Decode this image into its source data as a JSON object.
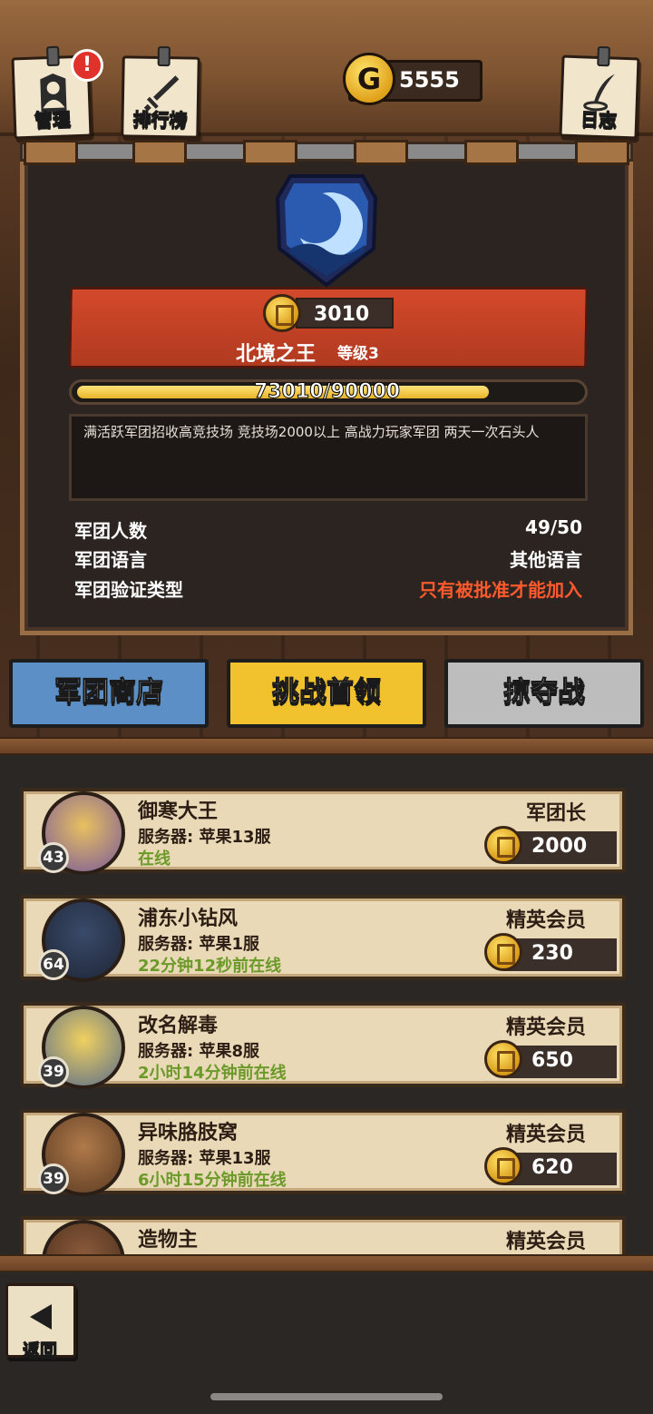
{
  "header": {
    "manage_label": "管理",
    "manage_alert": "!",
    "ranking_label": "排行榜",
    "log_label": "日志",
    "currency_symbol": "G",
    "currency_value": "5555"
  },
  "guild": {
    "points": "3010",
    "name": "北境之王",
    "level": "等级3",
    "progress_text": "73010/90000",
    "progress_current": 73010,
    "progress_max": 90000,
    "description": "满活跃军团招收高竞技场 竞技场2000以上 高战力玩家军团 两天一次石头人",
    "info": [
      {
        "label": "军团人数",
        "value": "49/50"
      },
      {
        "label": "军团语言",
        "value": "其他语言"
      },
      {
        "label": "军团验证类型",
        "value": "只有被批准才能加入"
      }
    ]
  },
  "actions": {
    "shop": "军团商店",
    "boss": "挑战首领",
    "raid": "掠夺战"
  },
  "members": [
    {
      "name": "御寒大王",
      "server": "服务器: 苹果13服",
      "status": "在线",
      "role": "军团长",
      "points": "2000",
      "level": "43"
    },
    {
      "name": "浦东小钻风",
      "server": "服务器: 苹果1服",
      "status": "22分钟12秒前在线",
      "role": "精英会员",
      "points": "230",
      "level": "64"
    },
    {
      "name": "改名解毒",
      "server": "服务器: 苹果8服",
      "status": "2小时14分钟前在线",
      "role": "精英会员",
      "points": "650",
      "level": "39"
    },
    {
      "name": "异味胳肢窝",
      "server": "服务器: 苹果13服",
      "status": "6小时15分钟前在线",
      "role": "精英会员",
      "points": "620",
      "level": "39"
    },
    {
      "name": "造物主",
      "server": "",
      "status": "",
      "role": "精英会员",
      "points": "",
      "level": ""
    }
  ],
  "footer": {
    "back_label": "返回"
  },
  "colors": {
    "banner_red": "#c8432a",
    "shop_blue": "#5b8fc5",
    "boss_yellow": "#f2c22e",
    "raid_gray": "#bdbdbd",
    "online_green": "#6b9a2a",
    "requirement_orange": "#ff5a2e"
  }
}
